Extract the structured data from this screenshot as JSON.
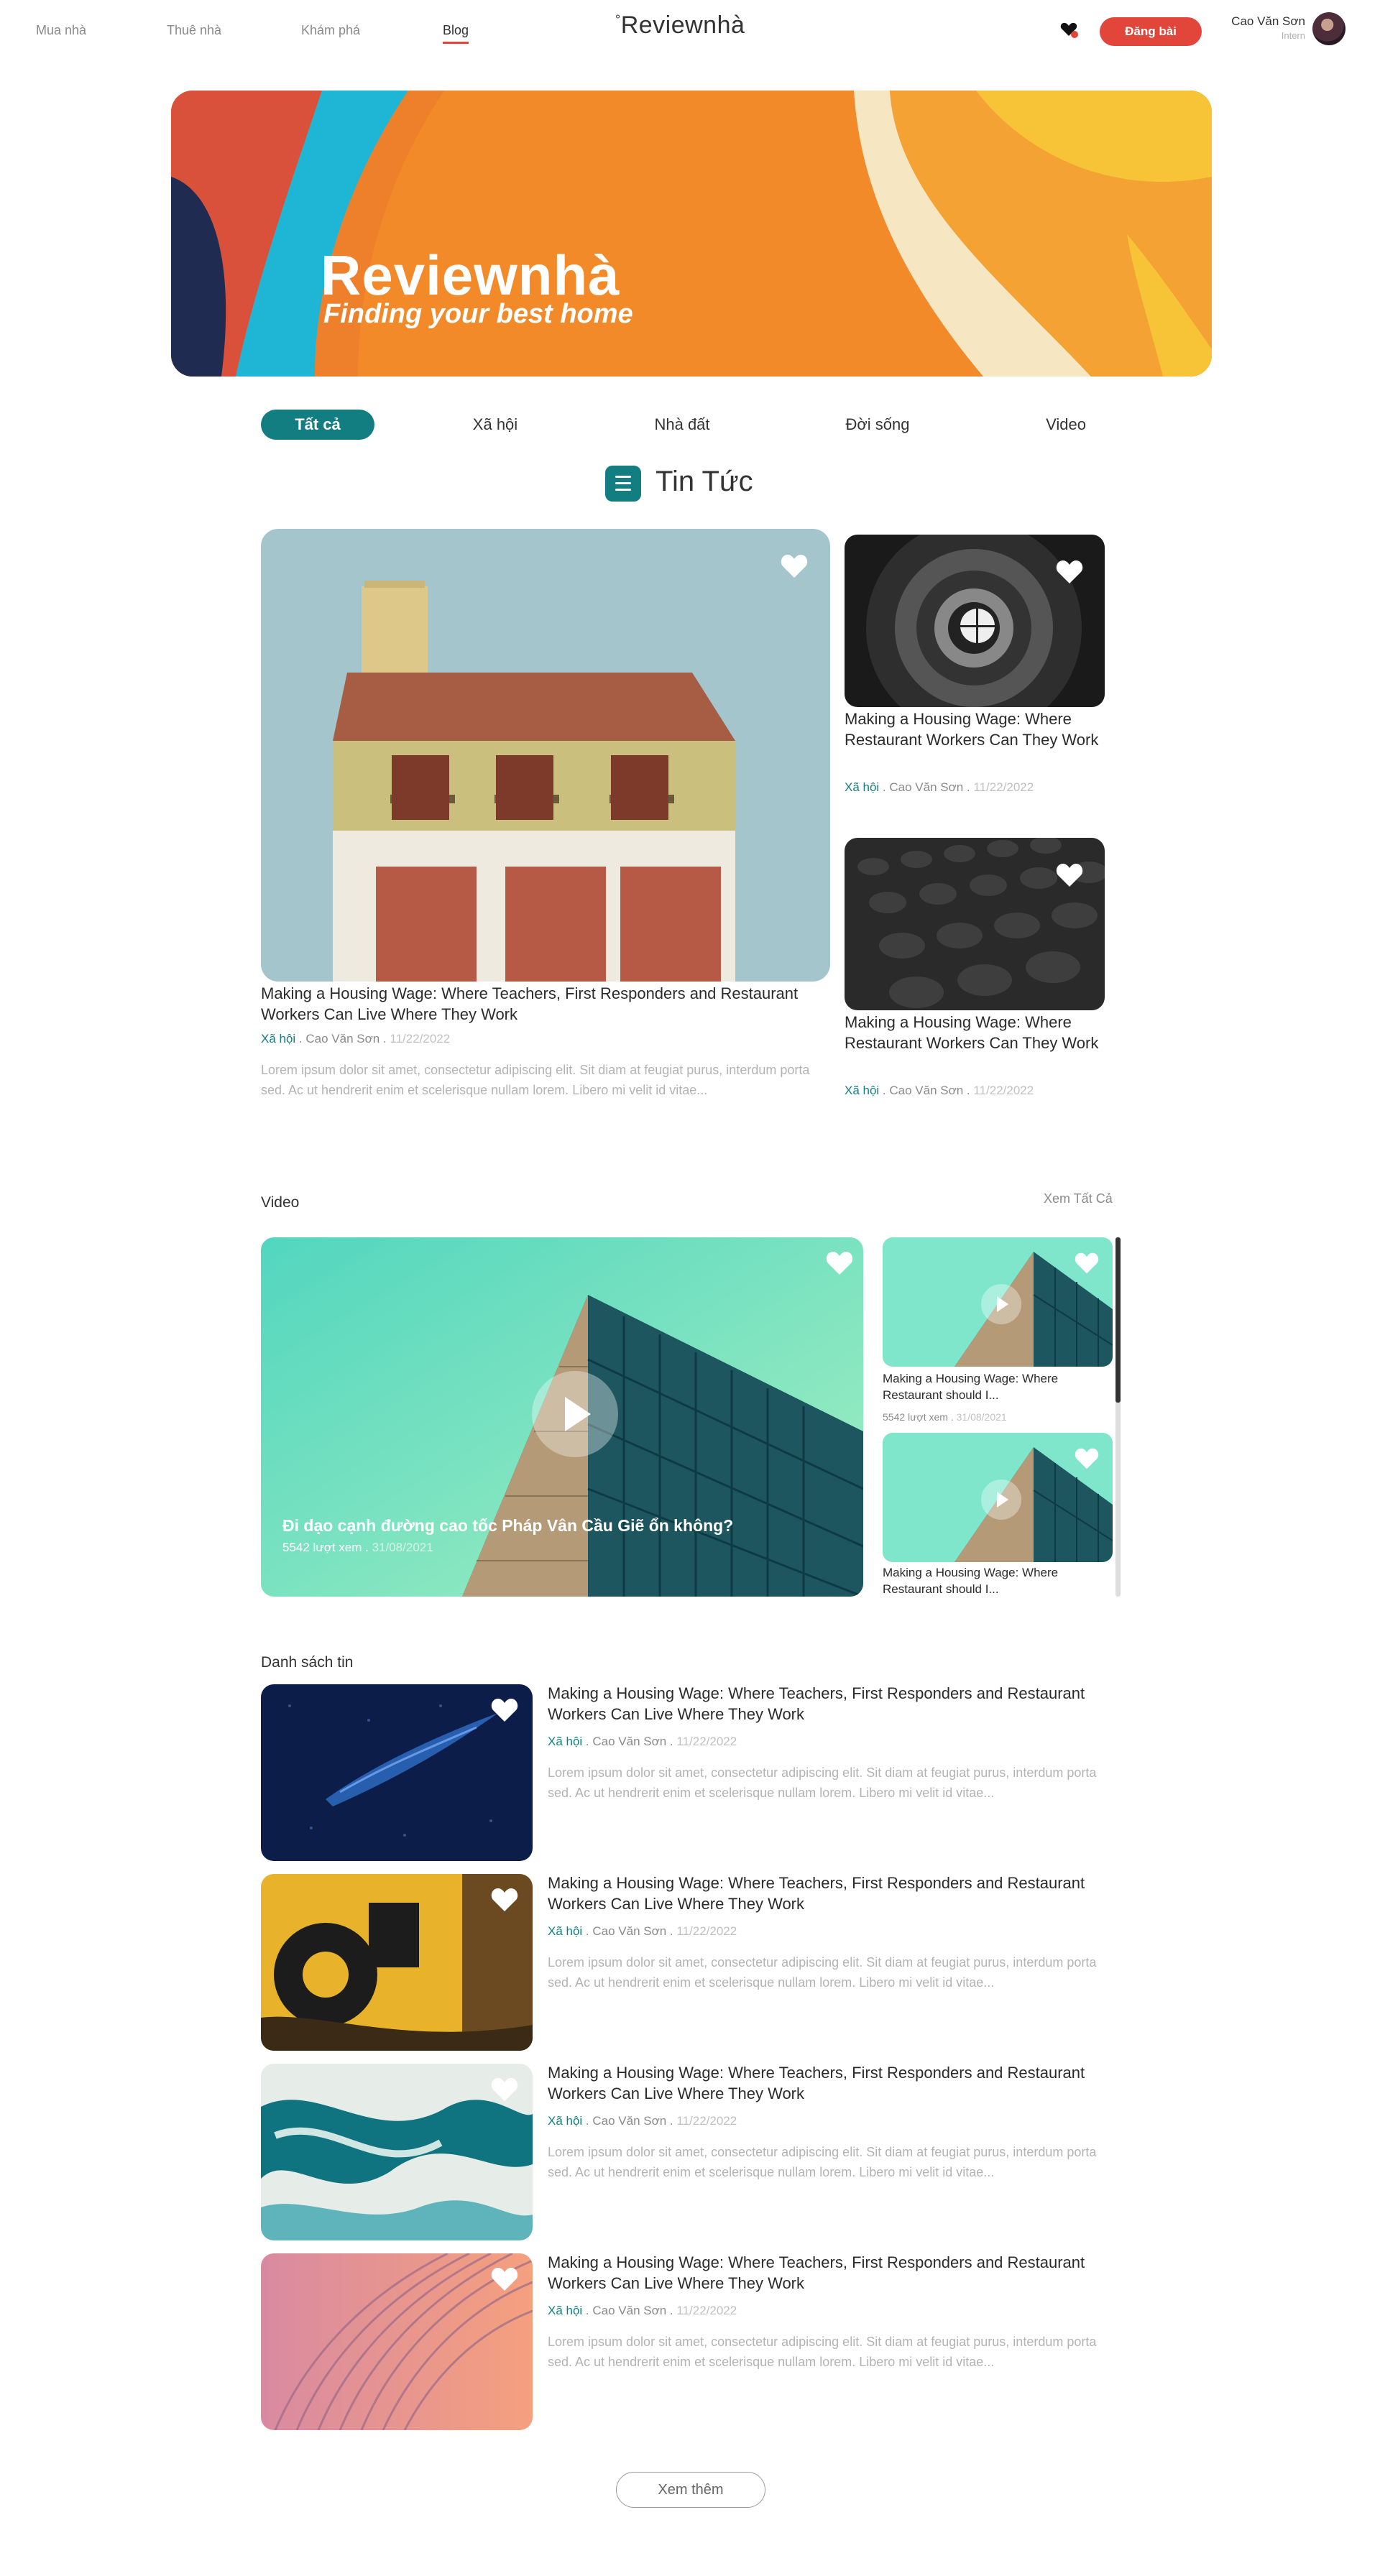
{
  "header": {
    "nav": [
      "Mua nhà",
      "Thuê nhà",
      "Khám phá",
      "Blog"
    ],
    "active_nav": "Blog",
    "logo_mark": "°",
    "logo_text": "Reviewnhà",
    "post_button": "Đăng bài",
    "user_name": "Cao Văn Sơn",
    "user_role": "Intern",
    "icon": "heart-notification-icon"
  },
  "hero": {
    "title": "Reviewnhà",
    "subtitle": "Finding your best home"
  },
  "tabs": [
    "Tất cả",
    "Xã hội",
    "Nhà đất",
    "Đời sống",
    "Video"
  ],
  "active_tab": "Tất cả",
  "news": {
    "section_title": "Tin Tức",
    "featured": {
      "title": "Making a Housing Wage: Where Teachers, First Responders and Restaurant Workers Can Live Where They Work",
      "category": "Xã hội",
      "author": "Cao Văn Sơn",
      "date": "11/22/2022",
      "excerpt": "Lorem ipsum dolor sit amet, consectetur adipiscing elit. Sit diam at feugiat purus, interdum porta sed. Ac ut hendrerit enim et scelerisque nullam lorem. Libero mi velit id vitae..."
    },
    "side": [
      {
        "title": "Making a Housing Wage: Where Restaurant Workers Can They Work",
        "category": "Xã hội",
        "author": "Cao Văn Sơn",
        "date": "11/22/2022"
      },
      {
        "title": "Making a Housing Wage: Where Restaurant Workers Can They Work",
        "category": "Xã hội",
        "author": "Cao Văn Sơn",
        "date": "11/22/2022"
      }
    ]
  },
  "video": {
    "section_title": "Video",
    "see_all": "Xem Tất Cả",
    "main": {
      "title": "Đi dạo cạnh đường cao tốc Pháp Vân Cầu Giẽ ổn không?",
      "views": "5542 lượt xem",
      "date": "31/08/2021"
    },
    "side": [
      {
        "title": "Making a Housing Wage: Where Restaurant should I...",
        "views": "5542 lượt xem",
        "date": "31/08/2021"
      },
      {
        "title": "Making a Housing Wage: Where Restaurant should I...",
        "views": "",
        "date": ""
      }
    ]
  },
  "list": {
    "section_title": "Danh sách tin",
    "items": [
      {
        "title": "Making a Housing Wage: Where Teachers, First Responders and Restaurant Workers Can Live Where They Work",
        "category": "Xã hội",
        "author": "Cao Văn Sơn",
        "date": "11/22/2022",
        "excerpt": "Lorem ipsum dolor sit amet, consectetur adipiscing elit. Sit diam at feugiat purus, interdum porta sed. Ac ut hendrerit enim et scelerisque nullam lorem. Libero mi velit id vitae..."
      },
      {
        "title": "Making a Housing Wage: Where Teachers, First Responders and Restaurant Workers Can Live Where They Work",
        "category": "Xã hội",
        "author": "Cao Văn Sơn",
        "date": "11/22/2022",
        "excerpt": "Lorem ipsum dolor sit amet, consectetur adipiscing elit. Sit diam at feugiat purus, interdum porta sed. Ac ut hendrerit enim et scelerisque nullam lorem. Libero mi velit id vitae..."
      },
      {
        "title": "Making a Housing Wage: Where Teachers, First Responders and Restaurant Workers Can Live Where They Work",
        "category": "Xã hội",
        "author": "Cao Văn Sơn",
        "date": "11/22/2022",
        "excerpt": "Lorem ipsum dolor sit amet, consectetur adipiscing elit. Sit diam at feugiat purus, interdum porta sed. Ac ut hendrerit enim et scelerisque nullam lorem. Libero mi velit id vitae..."
      },
      {
        "title": "Making a Housing Wage: Where Teachers, First Responders and Restaurant Workers Can Live Where They Work",
        "category": "Xã hội",
        "author": "Cao Văn Sơn",
        "date": "11/22/2022",
        "excerpt": "Lorem ipsum dolor sit amet, consectetur adipiscing elit. Sit diam at feugiat purus, interdum porta sed. Ac ut hendrerit enim et scelerisque nullam lorem. Libero mi velit id vitae..."
      }
    ],
    "more_button": "Xem thêm"
  },
  "colors": {
    "accent": "#137e82",
    "brand_red": "#e2463a"
  }
}
